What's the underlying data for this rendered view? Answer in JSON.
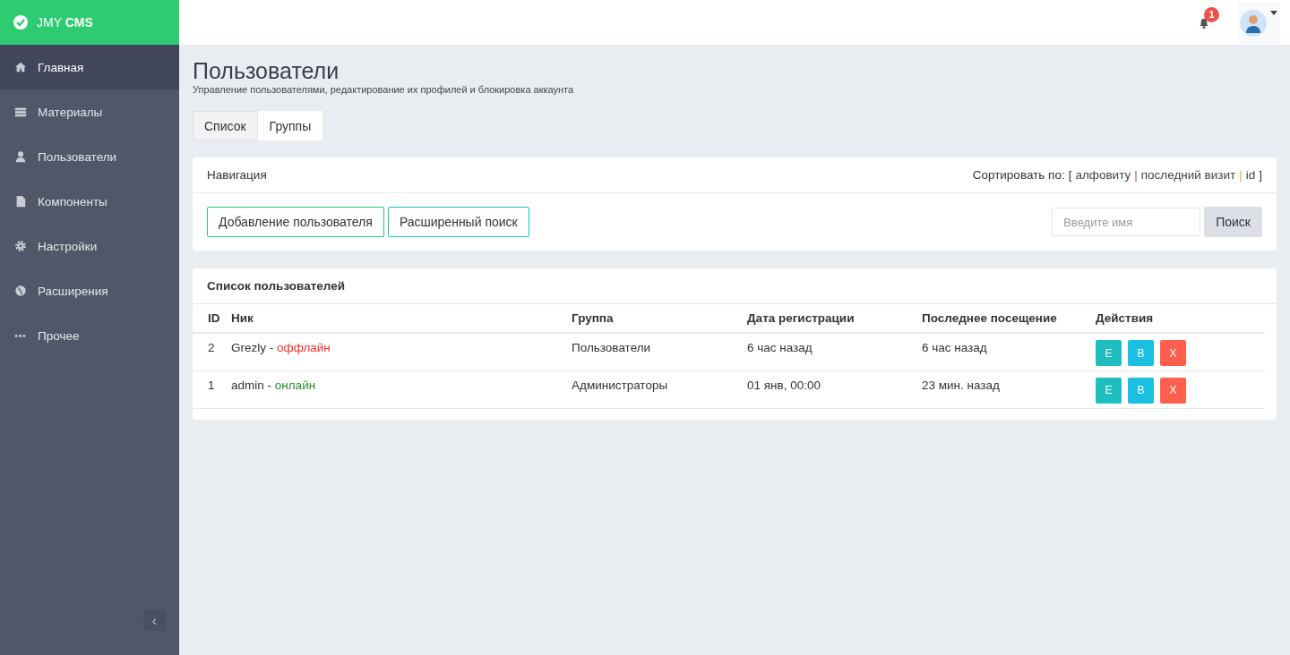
{
  "brand": {
    "name": "JMY",
    "name_bold": "CMS"
  },
  "sidebar": {
    "items": [
      {
        "label": "Главная",
        "selected": true
      },
      {
        "label": "Материалы",
        "selected": false
      },
      {
        "label": "Пользователи",
        "selected": false
      },
      {
        "label": "Компоненты",
        "selected": false
      },
      {
        "label": "Настройки",
        "selected": false
      },
      {
        "label": "Расширения",
        "selected": false
      },
      {
        "label": "Прочее",
        "selected": false
      }
    ],
    "collapse": "‹"
  },
  "topbar": {
    "notifications": "1"
  },
  "page": {
    "title": "Пользователи",
    "subtitle": "Управление пользователями, редактирование их профилей и блокировка аккаунта"
  },
  "tabs": [
    {
      "label": "Список",
      "selected": true
    },
    {
      "label": "Группы",
      "selected": false
    }
  ],
  "navigation": {
    "title": "Навигация",
    "sort_label": "Сортировать по:",
    "open_bracket": "[",
    "sort_links": [
      "алфовиту",
      "последний визит",
      "id"
    ],
    "separator": "|",
    "close_bracket": "]",
    "buttons": [
      "Добавление пользователя",
      "Расширенный поиск"
    ],
    "search": {
      "placeholder": "Введите имя",
      "button": "Поиск"
    }
  },
  "users": {
    "title": "Список пользователей",
    "columns": [
      "ID",
      "Ник",
      "Группа",
      "Дата регистрации",
      "Последнее посещение",
      "Действия"
    ],
    "rows": [
      {
        "id": "2",
        "nick": "Grezly -",
        "status": "оффлайн",
        "online": false,
        "group": "Пользователи",
        "registered": "6 час назад",
        "last_visit": "6 час назад",
        "actions": [
          {
            "label": "E",
            "kind": "edit"
          },
          {
            "label": "B",
            "kind": "ban"
          },
          {
            "label": "X",
            "kind": "delete"
          }
        ]
      },
      {
        "id": "1",
        "nick": "admin -",
        "status": "онлайн",
        "online": true,
        "group": "Администраторы",
        "registered": "01 янв, 00:00",
        "last_visit": "23 мин. назад",
        "actions": [
          {
            "label": "E",
            "kind": "edit"
          },
          {
            "label": "B",
            "kind": "ban"
          },
          {
            "label": "X",
            "kind": "delete"
          }
        ]
      }
    ]
  }
}
